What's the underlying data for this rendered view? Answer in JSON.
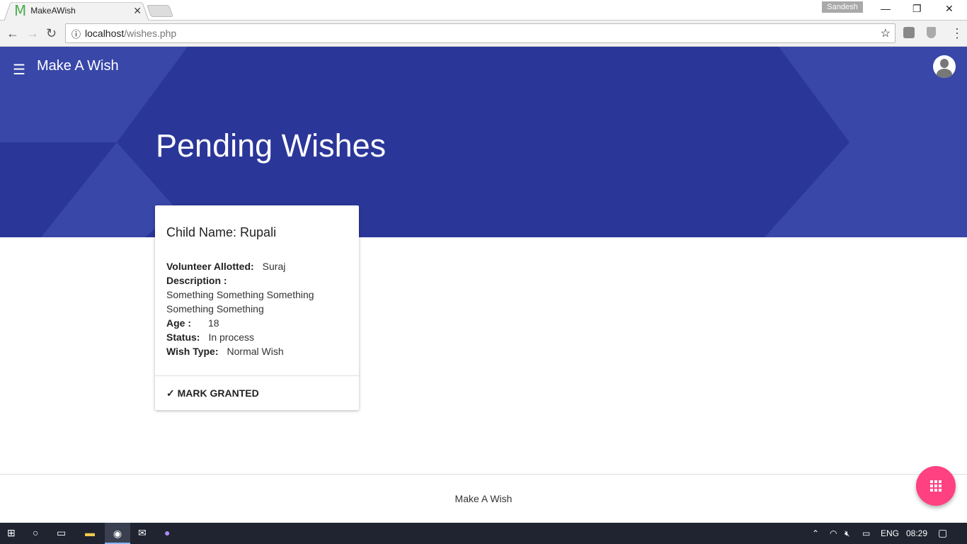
{
  "browser": {
    "tab_title": "MakeAWish",
    "favicon": "M",
    "url_host": "localhost",
    "url_path": "/wishes.php",
    "profile": "Sandesh"
  },
  "app": {
    "brand": "Make A Wish",
    "page_title": "Pending Wishes",
    "accent": "#2b3699",
    "fab_color": "#ff4081"
  },
  "card": {
    "title": "Child Name: Rupali",
    "fields": [
      {
        "label": "Volunteer Allotted:",
        "value": "Suraj"
      },
      {
        "label": "Description :",
        "value": "Something Something Something Something Something"
      },
      {
        "label": "Age :",
        "value": "18"
      },
      {
        "label": "Status:",
        "value": "In process"
      },
      {
        "label": "Wish Type:",
        "value": "Normal Wish"
      }
    ],
    "action": "MARK GRANTED"
  },
  "footer": {
    "text": "Make A Wish"
  },
  "taskbar": {
    "lang": "ENG",
    "time": "08:29"
  }
}
